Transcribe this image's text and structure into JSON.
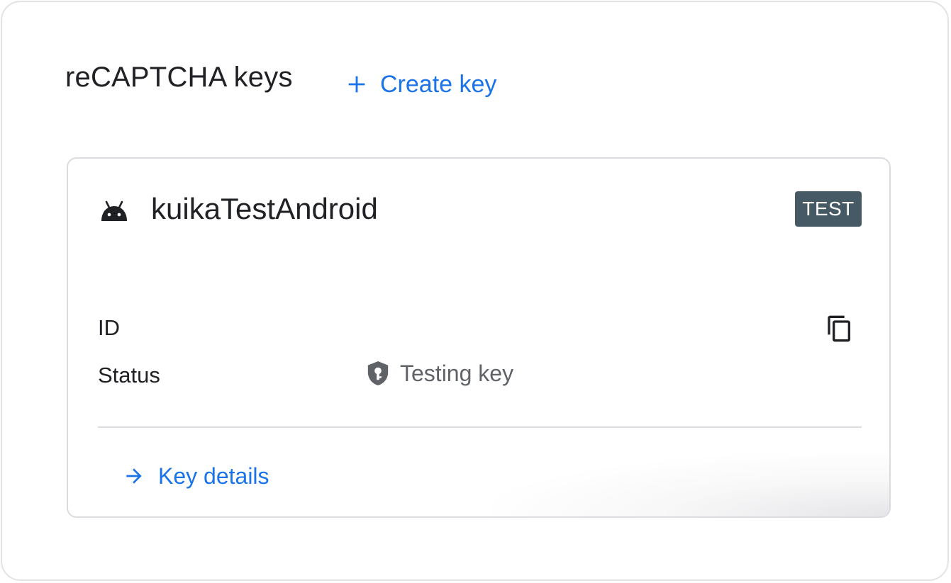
{
  "header": {
    "title": "reCAPTCHA keys",
    "create_key_label": "Create key"
  },
  "key_card": {
    "name": "kuika TestAndroid",
    "name_display": "kuikaTestAndroid",
    "platform_icon": "android-icon",
    "badge": "TEST",
    "rows": {
      "id_label": "ID",
      "id_value": "",
      "status_label": "Status",
      "status_value": "Testing key"
    },
    "details_label": "Key details"
  },
  "icons": {
    "create": "plus-icon",
    "copy": "copy-icon",
    "status": "shield-key-icon",
    "details": "arrow-right-icon"
  },
  "colors": {
    "accent": "#1a73e8",
    "badge_bg": "#455a64",
    "text": "#202124",
    "muted": "#5f6368",
    "border": "#dadce0"
  }
}
